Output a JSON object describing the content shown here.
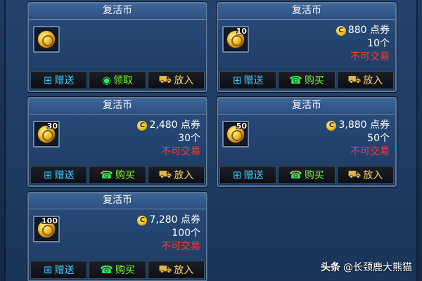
{
  "cards": [
    {
      "title": "复活币",
      "qty_badge": "",
      "price": "",
      "count": "",
      "tradeable": "",
      "buttons": [
        {
          "icon": "gift-icon",
          "label": "赠送"
        },
        {
          "icon": "claim-icon",
          "label": "领取"
        },
        {
          "icon": "cart-icon",
          "label": "放入"
        }
      ]
    },
    {
      "title": "复活币",
      "qty_badge": "10",
      "price": "880 点券",
      "count": "10个",
      "tradeable": "不可交易",
      "buttons": [
        {
          "icon": "gift-icon",
          "label": "赠送"
        },
        {
          "icon": "buy-icon",
          "label": "购买"
        },
        {
          "icon": "cart-icon",
          "label": "放入"
        }
      ]
    },
    {
      "title": "复活币",
      "qty_badge": "30",
      "price": "2,480 点券",
      "count": "30个",
      "tradeable": "不可交易",
      "buttons": [
        {
          "icon": "gift-icon",
          "label": "赠送"
        },
        {
          "icon": "buy-icon",
          "label": "购买"
        },
        {
          "icon": "cart-icon",
          "label": "放入"
        }
      ]
    },
    {
      "title": "复活币",
      "qty_badge": "50",
      "price": "3,880 点券",
      "count": "50个",
      "tradeable": "不可交易",
      "buttons": [
        {
          "icon": "gift-icon",
          "label": "赠送"
        },
        {
          "icon": "buy-icon",
          "label": "购买"
        },
        {
          "icon": "cart-icon",
          "label": "放入"
        }
      ]
    },
    {
      "title": "复活币",
      "qty_badge": "100",
      "price": "7,280 点券",
      "count": "100个",
      "tradeable": "不可交易",
      "buttons": [
        {
          "icon": "gift-icon",
          "label": "赠送"
        },
        {
          "icon": "buy-icon",
          "label": "购买"
        },
        {
          "icon": "cart-icon",
          "label": "放入"
        }
      ]
    }
  ],
  "currency_icon": "C",
  "watermark": {
    "brand": "头条",
    "handle": "@长颈鹿大熊猫"
  },
  "colors": {
    "tradeable": "#ff3b30",
    "gift": "#3ec7ff",
    "green": "#7df23b",
    "put": "#ffd36b"
  }
}
